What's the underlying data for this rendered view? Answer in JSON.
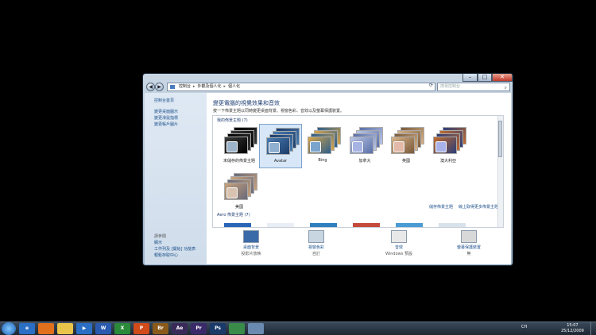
{
  "window": {
    "caption_min": "–",
    "caption_max": "□",
    "caption_close": "✕",
    "back_glyph": "◀",
    "forward_glyph": "▶",
    "address": {
      "crumbs": [
        "控制台",
        "外觀及個人化",
        "個人化"
      ],
      "separator": "▸"
    },
    "refresh_glyph": "⟳",
    "search_placeholder": "搜尋控制台",
    "search_glyph": "⌕"
  },
  "sidebar": {
    "home_link": "控制台首頁",
    "links": [
      "變更桌面圖示",
      "變更滑鼠指標",
      "變更帳戶圖片"
    ],
    "see_also_title": "請參閱",
    "see_also": [
      "顯示",
      "工作列及 [開始] 功能表",
      "輕鬆存取中心"
    ]
  },
  "main": {
    "heading": "變更電腦的視覺效果和音效",
    "description": "按一下佈景主題以同時變更桌面背景、視窗色彩、音效以及螢幕保護裝置。",
    "my_themes_title": "我的佈景主題 (7)",
    "themes": [
      {
        "label": "未儲存的佈景主題",
        "colors": [
          "#000000",
          "#3a3a3a"
        ],
        "swatch": "#9db3c9"
      },
      {
        "label": "Avatar",
        "colors": [
          "#1b3d6b",
          "#4a7db3"
        ],
        "swatch": "#8fb0d0",
        "selected": true
      },
      {
        "label": "Bing",
        "colors": [
          "#2b5e8c",
          "#d8a546"
        ],
        "swatch": "#7aa4cc"
      },
      {
        "label": "加拿大",
        "colors": [
          "#5a6fa8",
          "#bcc7e8"
        ],
        "swatch": "#a7b3e3"
      },
      {
        "label": "英國",
        "colors": [
          "#7a5a3a",
          "#d8b48a"
        ],
        "swatch": "#e3b9a7"
      },
      {
        "label": "澳大利亞",
        "colors": [
          "#2a3d7a",
          "#c46a2a"
        ],
        "swatch": "#a9b2e8"
      },
      {
        "label": "美國",
        "colors": [
          "#6a6a7a",
          "#c9a27a"
        ],
        "swatch": "#d9c3b0"
      }
    ],
    "save_theme_link": "儲存佈景主題",
    "online_themes_link": "線上取得更多佈景主題",
    "aero_title": "Aero 佈景主題 (7)",
    "aero_strip": [
      "#2a66b8",
      "#e8eef4",
      "#2f7fbf",
      "#c44a3a",
      "#4a9ad4",
      "#d8e2ea"
    ]
  },
  "bottom": [
    {
      "label": "桌面背景",
      "sub": "投影片放映",
      "color": "#3a6aa8"
    },
    {
      "label": "視窗色彩",
      "sub": "自訂",
      "color": "#c8d6e2"
    },
    {
      "label": "音效",
      "sub": "Windows 預設",
      "color": "#e8e8e8"
    },
    {
      "label": "螢幕保護裝置",
      "sub": "無",
      "color": "#d8d8d8"
    }
  ],
  "taskbar": {
    "apps": [
      {
        "name": "ie",
        "text": "e",
        "color": "#2a6fc4"
      },
      {
        "name": "firefox",
        "text": "",
        "color": "#e0701c"
      },
      {
        "name": "explorer",
        "text": "",
        "color": "#e8c44a"
      },
      {
        "name": "media",
        "text": "▶",
        "color": "#2a6fc4"
      },
      {
        "name": "word",
        "text": "W",
        "color": "#2a5ab0"
      },
      {
        "name": "excel",
        "text": "X",
        "color": "#2a8a3a"
      },
      {
        "name": "powerpoint",
        "text": "P",
        "color": "#d04a1a"
      },
      {
        "name": "bridge",
        "text": "Br",
        "color": "#8a5a1a"
      },
      {
        "name": "aftereffects",
        "text": "Ae",
        "color": "#3a2a5a"
      },
      {
        "name": "premiere",
        "text": "Pr",
        "color": "#3a2a6a"
      },
      {
        "name": "photoshop",
        "text": "Ps",
        "color": "#1a3a6a"
      },
      {
        "name": "controlpanel",
        "text": "",
        "color": "#3a8a4a"
      },
      {
        "name": "active-window",
        "text": "",
        "color": "#6a8ab0"
      }
    ],
    "tray_lang": "CH",
    "time": "15:07",
    "date": "25/12/2009"
  }
}
